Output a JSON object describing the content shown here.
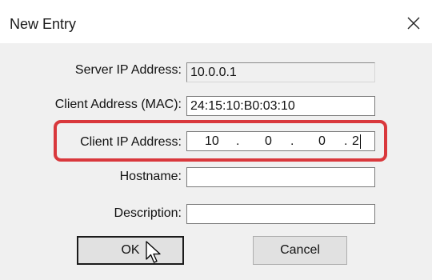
{
  "dialog": {
    "title": "New Entry",
    "close_icon": "close-icon"
  },
  "fields": {
    "server_ip": {
      "label": "Server IP Address:",
      "value": "10.0.0.1"
    },
    "client_mac": {
      "label": "Client Address (MAC):",
      "value": "24:15:10:B0:03:10"
    },
    "client_ip": {
      "label": "Client IP Address:",
      "octets": [
        "10",
        "0",
        "0",
        "2"
      ]
    },
    "hostname": {
      "label": "Hostname:",
      "value": ""
    },
    "description": {
      "label": "Description:",
      "value": ""
    }
  },
  "buttons": {
    "ok": "OK",
    "cancel": "Cancel"
  },
  "colors": {
    "highlight": "#d9383c"
  },
  "cursor_icon": "mouse-pointer-icon"
}
